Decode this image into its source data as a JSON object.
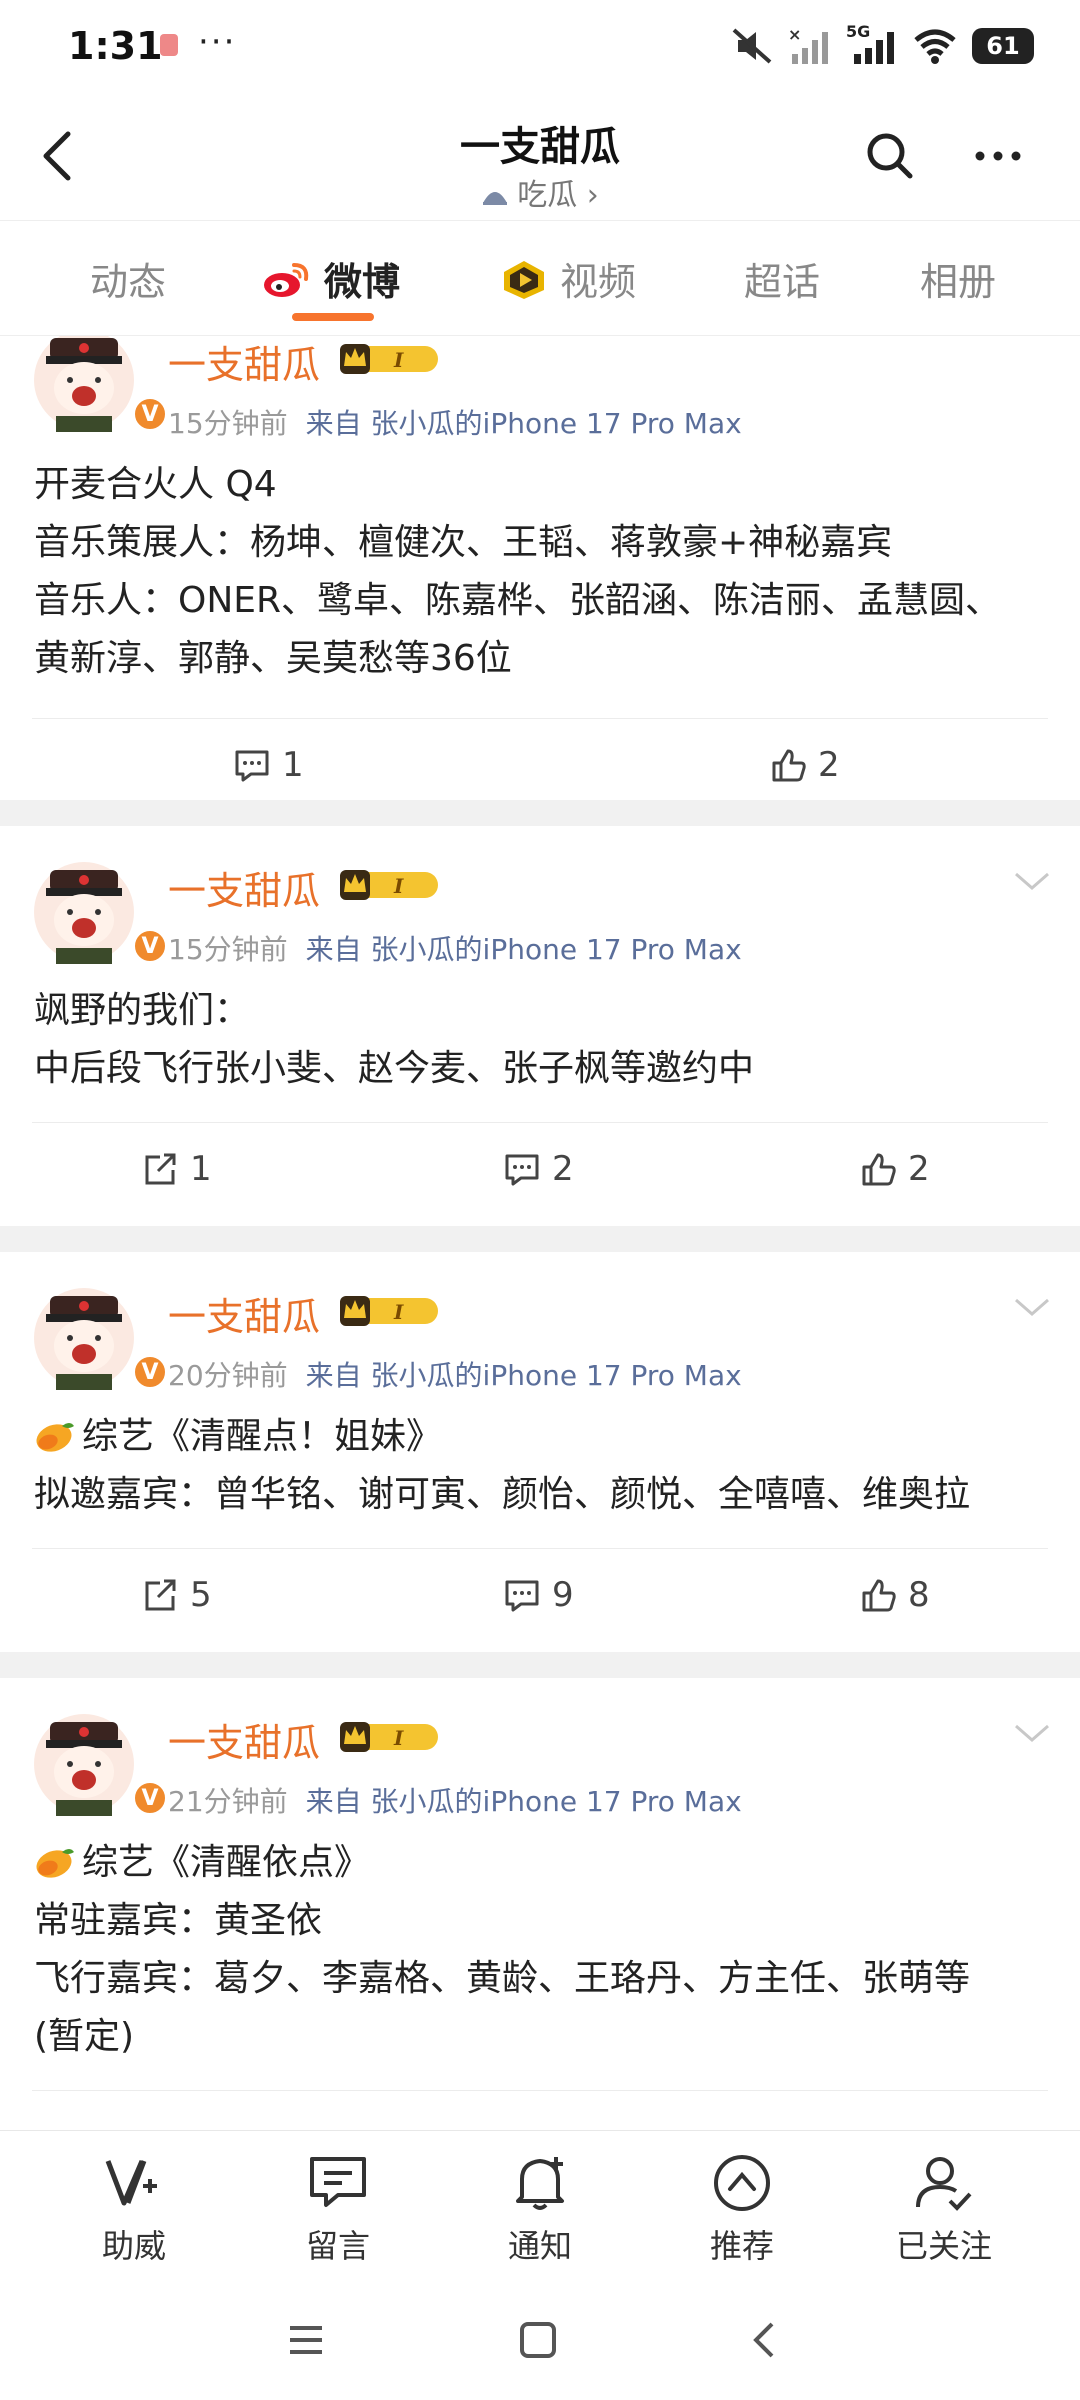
{
  "status_bar": {
    "time": "1:31",
    "network": "5G",
    "battery": "61"
  },
  "header": {
    "title": "一支甜瓜",
    "subtitle": "吃瓜 ›"
  },
  "tabs": [
    "动态",
    "微博",
    "视频",
    "超话",
    "相册"
  ],
  "posts": [
    {
      "author": "一支甜瓜",
      "time": "15分钟前",
      "source": "来自 张小瓜的iPhone 17 Pro Max",
      "lines": [
        "开麦合火人 Q4",
        "音乐策展人：杨坤、檀健次、王韬、蒋敦豪+神秘嘉宾",
        "音乐人：ONER、鹭卓、陈嘉桦、张韶涵、陈洁丽、孟慧圆、",
        "黄新淳、郭静、吴莫愁等36位"
      ],
      "comments": "1",
      "likes": "2"
    },
    {
      "author": "一支甜瓜",
      "time": "15分钟前",
      "source": "来自 张小瓜的iPhone 17 Pro Max",
      "lines": [
        "飒野的我们：",
        "中后段飞行张小斐、赵今麦、张子枫等邀约中"
      ],
      "reposts": "1",
      "comments": "2",
      "likes": "2"
    },
    {
      "author": "一支甜瓜",
      "time": "20分钟前",
      "source": "来自 张小瓜的iPhone 17 Pro Max",
      "lines": [
        "综艺《清醒点！姐妹》",
        "拟邀嘉宾：曾华铭、谢可寅、颜怡、颜悦、全嘻嘻、维奥拉"
      ],
      "reposts": "5",
      "comments": "9",
      "likes": "8"
    },
    {
      "author": "一支甜瓜",
      "time": "21分钟前",
      "source": "来自 张小瓜的iPhone 17 Pro Max",
      "lines": [
        "综艺《清醒依点》",
        "常驻嘉宾：黄圣依",
        "飞行嘉宾：葛夕、李嘉格、黄龄、王珞丹、方主任、张萌等",
        "(暂定)"
      ]
    }
  ],
  "bottom_nav": [
    "助威",
    "留言",
    "通知",
    "推荐",
    "已关注"
  ],
  "colors": {
    "accent": "#f7742d",
    "name": "#e8712a",
    "source": "#5a6e9a"
  }
}
